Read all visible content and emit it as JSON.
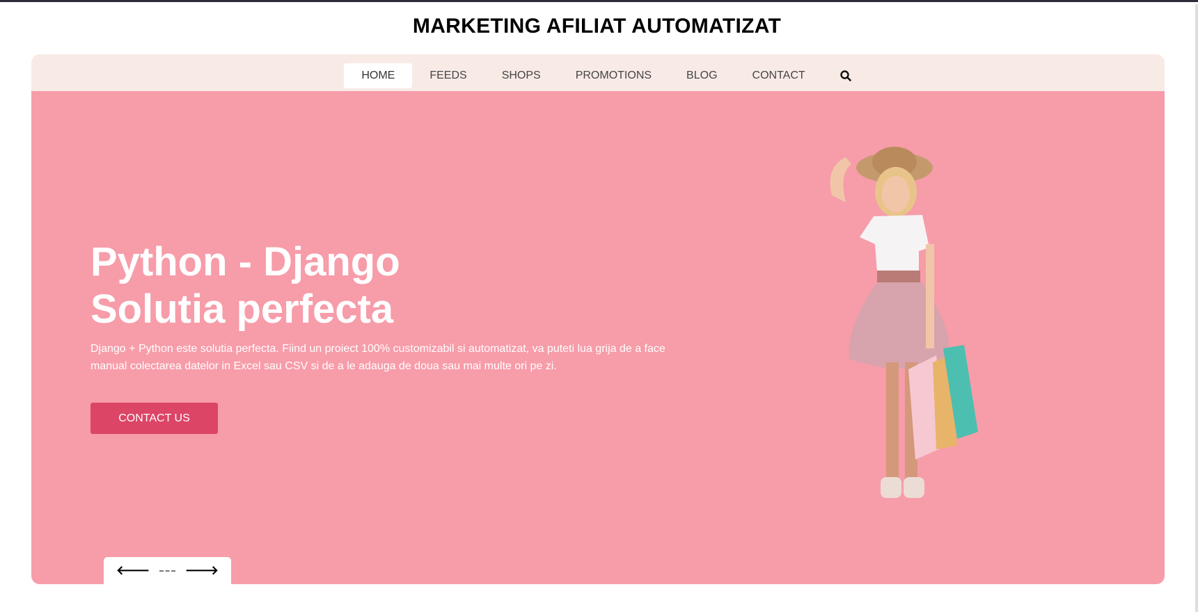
{
  "header": {
    "title": "MARKETING AFILIAT AUTOMATIZAT"
  },
  "nav": {
    "items": [
      {
        "label": "HOME",
        "active": true
      },
      {
        "label": "FEEDS"
      },
      {
        "label": "SHOPS"
      },
      {
        "label": "PROMOTIONS"
      },
      {
        "label": "BLOG"
      },
      {
        "label": "CONTACT"
      }
    ],
    "search_icon": "search-icon"
  },
  "hero": {
    "headline_line1": "Python - Django",
    "headline_line2": "Solutia perfecta",
    "description": "Django + Python este solutia perfecta. Fiind un proiect 100% customizabil si automatizat, va puteti lua grija de a face manual colectarea datelor in Excel sau CSV si de a le adauga de doua sau mai multe ori pe zi.",
    "cta_label": "CONTACT US",
    "prev_icon": "arrow-left-icon",
    "next_icon": "arrow-right-icon",
    "prev_glyph": "🡐",
    "next_glyph": "🡒"
  },
  "colors": {
    "hero_bg": "#f79ca9",
    "nav_bg": "#f8ebe6",
    "cta": "#dc4566"
  }
}
